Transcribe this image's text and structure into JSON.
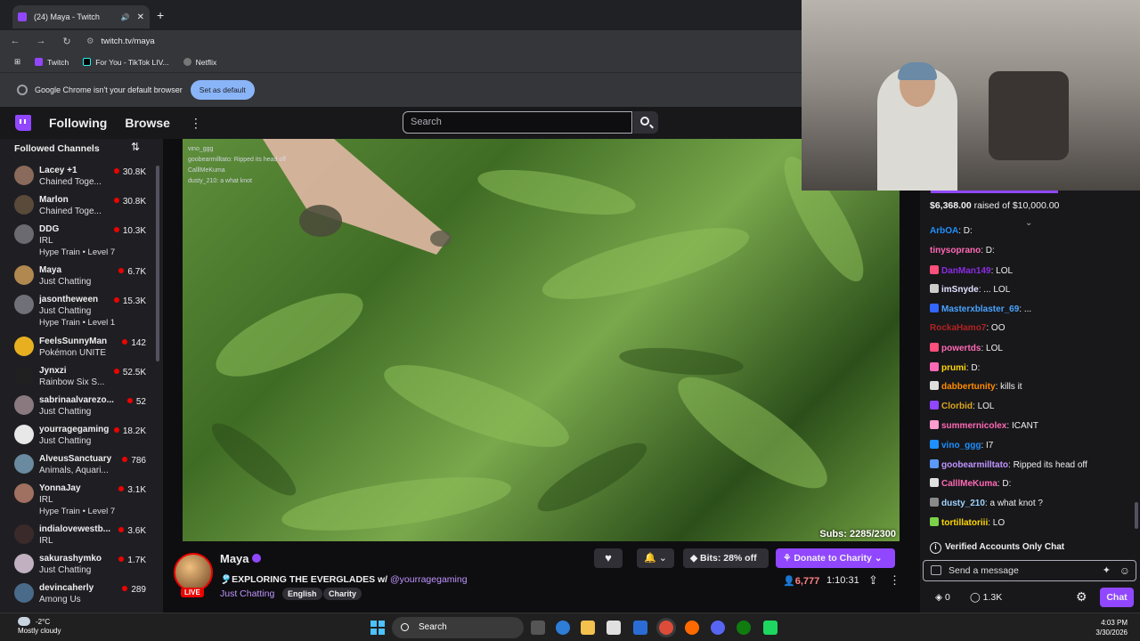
{
  "browser": {
    "tab_title": "(24) Maya - Twitch",
    "url": "twitch.tv/maya",
    "bookmarks": [
      "Twitch",
      "For You - TikTok LIV...",
      "Netflix"
    ],
    "default_notice": "Google Chrome isn't your default browser",
    "default_button": "Set as default"
  },
  "nav": {
    "following": "Following",
    "browse": "Browse",
    "more": "⋮",
    "search_placeholder": "Search"
  },
  "sidebar": {
    "heading": "Followed Channels",
    "sort_icon": "⇅",
    "channels": [
      {
        "name": "Lacey +1",
        "game": "Chained Toge...",
        "viewers": "30.8K",
        "avatar_color": "#8a6a5a"
      },
      {
        "name": "Marlon",
        "game": "Chained Toge...",
        "viewers": "30.8K",
        "avatar_color": "#5a4a3a"
      },
      {
        "name": "DDG",
        "game": "IRL",
        "viewers": "10.3K",
        "hype": "Hype Train • Level 7",
        "avatar_color": "#6a6a70"
      },
      {
        "name": "Maya",
        "game": "Just Chatting",
        "viewers": "6.7K",
        "avatar_color": "#b08850"
      },
      {
        "name": "jasontheween",
        "game": "Just Chatting",
        "viewers": "15.3K",
        "hype": "Hype Train • Level 1",
        "avatar_color": "#707078"
      },
      {
        "name": "FeelsSunnyMan",
        "game": "Pokémon UNITE",
        "viewers": "142",
        "avatar_color": "#e8b020"
      },
      {
        "name": "Jynxzi",
        "game": "Rainbow Six S...",
        "viewers": "52.5K",
        "avatar_color": "#202020"
      },
      {
        "name": "sabrinaalvarezo...",
        "game": "Just Chatting",
        "viewers": "52",
        "avatar_color": "#8a7a80"
      },
      {
        "name": "yourragegaming",
        "game": "Just Chatting",
        "viewers": "18.2K",
        "avatar_color": "#e8e8e8"
      },
      {
        "name": "AlveusSanctuary",
        "game": "Animals, Aquari...",
        "viewers": "786",
        "avatar_color": "#6a8aa0"
      },
      {
        "name": "YonnaJay",
        "game": "IRL",
        "viewers": "3.1K",
        "hype": "Hype Train • Level 7",
        "avatar_color": "#a07060"
      },
      {
        "name": "indialovewestb...",
        "game": "IRL",
        "viewers": "3.6K",
        "avatar_color": "#3a2a2a"
      },
      {
        "name": "sakurashymko",
        "game": "Just Chatting",
        "viewers": "1.7K",
        "avatar_color": "#c0b0c0"
      },
      {
        "name": "devincaherly",
        "game": "Among Us",
        "viewers": "289",
        "avatar_color": "#4a6a8a"
      }
    ]
  },
  "player": {
    "subs_overlay": "Subs: 2285/2300",
    "overlay_chat": [
      "vino_ggg",
      "goobearmilltato: Ripped its head off",
      "CalllMeKuma",
      "dusty_210: a what knot"
    ]
  },
  "stream": {
    "streamer": "Maya",
    "title_prefix": "🎐EXPLORING THE EVERGLADES w/ ",
    "title_mention": "@yourragegaming",
    "category": "Just Chatting",
    "tags": [
      "English",
      "Charity"
    ],
    "live_label": "LIVE",
    "bits_label": "Bits: 28% off",
    "donate_label": "Donate to Charity",
    "viewers": "6,777",
    "uptime": "1:10:31"
  },
  "chat": {
    "charity_raised": "$6,368.00",
    "charity_goal": "raised of $10,000.00",
    "messages": [
      {
        "user": "ArbOA",
        "text": "D:",
        "color": "#1e90ff",
        "badge": ""
      },
      {
        "user": "tinysoprano",
        "text": "D:",
        "color": "#ff69b4",
        "badge": ""
      },
      {
        "user": "DanMan149",
        "text": "LOL",
        "color": "#8a2be2",
        "badge": "#ff4f7a"
      },
      {
        "user": "imSnyde",
        "text": "... LOL",
        "color": "#e0e0ff",
        "badge": "#cccccc"
      },
      {
        "user": "Masterxblaster_69",
        "text": "...",
        "color": "#4aa3ff",
        "badge": "#3366ff"
      },
      {
        "user": "RockaHamo7",
        "text": "OO",
        "color": "#b22222",
        "badge": ""
      },
      {
        "user": "powertds",
        "text": "LOL",
        "color": "#ff69b4",
        "badge": "#ff4f7a"
      },
      {
        "user": "prumi",
        "text": "D:",
        "color": "#ffd700",
        "badge": "#ff69b4"
      },
      {
        "user": "dabbertunity",
        "text": "kills it",
        "color": "#ff8c00",
        "badge": "#dddddd"
      },
      {
        "user": "Clorbid",
        "text": "LOL",
        "color": "#daa520",
        "badge": "#9147ff"
      },
      {
        "user": "summernicolex",
        "text": "ICANT",
        "color": "#ff69b4",
        "badge": "#ff9ccd"
      },
      {
        "user": "vino_ggg",
        "text": "I7",
        "color": "#1e90ff",
        "badge": "#1e90ff"
      },
      {
        "user": "goobearmilltato",
        "text": "Ripped its head off",
        "color": "#bf94ff",
        "badge": "#5b99ff"
      },
      {
        "user": "CalllMeKuma",
        "text": "D:",
        "color": "#ff69b4",
        "badge": "#e0e0e0"
      },
      {
        "user": "dusty_210",
        "text": "a what knot ?",
        "color": "#9fd4ff",
        "badge": "#8a8a8a"
      },
      {
        "user": "tortillatoriii",
        "text": "LO",
        "color": "#ffd700",
        "badge": "#7bd148"
      }
    ],
    "verified_only": "Verified Accounts Only Chat",
    "send_placeholder": "Send a message",
    "points": "0",
    "points2": "1.3K",
    "chat_button": "Chat"
  },
  "taskbar": {
    "temp": "-2°C",
    "weather": "Mostly cloudy",
    "search": "Search",
    "time": "4:03 PM",
    "date": "3/30/2026"
  }
}
